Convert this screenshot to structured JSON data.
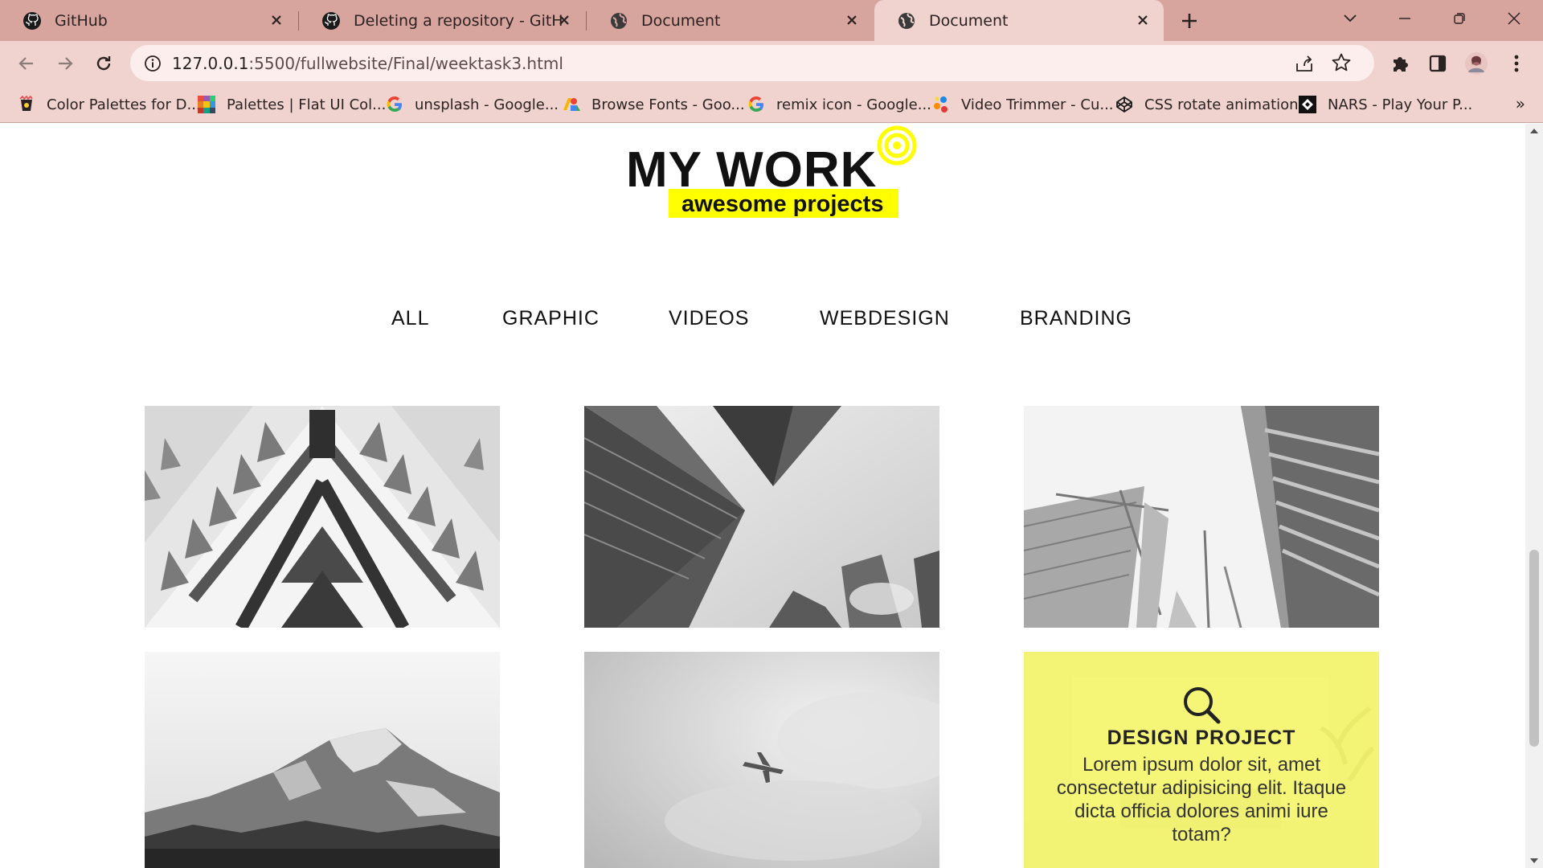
{
  "browser": {
    "tabs": [
      {
        "title": "GitHub",
        "icon": "github-icon",
        "active": false
      },
      {
        "title": "Deleting a repository - GitHub D",
        "icon": "github-icon",
        "active": false
      },
      {
        "title": "Document",
        "icon": "globe-icon",
        "active": false
      },
      {
        "title": "Document",
        "icon": "globe-icon",
        "active": true
      }
    ],
    "url": "127.0.0.1:5500/fullwebsite/Final/weektask3.html",
    "url_host": "127.0.0.1",
    "url_rest": ":5500/fullwebsite/Final/weektask3.html",
    "bookmarks": [
      {
        "label": "Color Palettes for D...",
        "icon": "palette-cup-icon"
      },
      {
        "label": "Palettes | Flat UI Col...",
        "icon": "flatui-icon"
      },
      {
        "label": "unsplash - Google...",
        "icon": "google-icon"
      },
      {
        "label": "Browse Fonts - Goo...",
        "icon": "google-fonts-icon"
      },
      {
        "label": "remix icon - Google...",
        "icon": "google-icon"
      },
      {
        "label": "Video Trimmer - Cu...",
        "icon": "video-trimmer-icon"
      },
      {
        "label": "CSS rotate animation",
        "icon": "codepen-icon"
      },
      {
        "label": "NARS - Play Your P...",
        "icon": "nars-icon"
      }
    ],
    "bookmarks_overflow": "»"
  },
  "page": {
    "heading": "MY WORK",
    "subtitle": "awesome projects",
    "accent_color": "#ffff00",
    "filters": [
      "ALL",
      "GRAPHIC",
      "VIDEOS",
      "WEBDESIGN",
      "BRANDING"
    ],
    "gallery": [
      {
        "name": "building-facade-photo"
      },
      {
        "name": "skyscrapers-upward-photo"
      },
      {
        "name": "towers-and-crane-photo"
      },
      {
        "name": "mountain-peak-photo"
      },
      {
        "name": "airplane-sky-photo"
      },
      {
        "name": "interior-room-photo",
        "overlay": {
          "icon": "search-icon",
          "title": "DESIGN PROJECT",
          "text": "Lorem ipsum dolor sit, amet consectetur adipisicing elit. Itaque dicta officia dolores animi iure totam?"
        }
      }
    ]
  }
}
